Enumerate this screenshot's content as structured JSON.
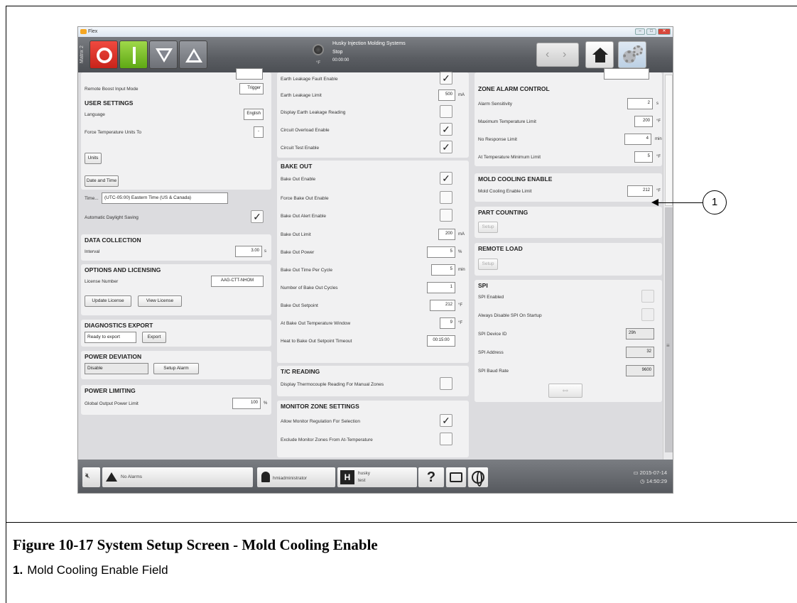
{
  "window": {
    "title": "Flex"
  },
  "header": {
    "matrix_label": "Matrix 2",
    "company": "Husky Injection Molding Systems",
    "state": "Stop",
    "time": "00:00:00",
    "temp_unit": "°F"
  },
  "col1": {
    "remote_boost_mode": {
      "label": "Remote Boost Input Mode",
      "value": "Trigger"
    },
    "user_settings": {
      "title": "USER SETTINGS",
      "language_label": "Language",
      "language_value": "English",
      "force_temp_label": "Force Temperature Units To",
      "force_temp_value": "-",
      "units_btn": "Units",
      "date_time_btn": "Date and Time",
      "time_label": "Time...",
      "time_value": "(UTC-05:00) Eastern Time (US & Canada)",
      "dst_label": "Automatic Daylight Saving"
    },
    "data_collection": {
      "title": "DATA COLLECTION",
      "interval_label": "Interval",
      "interval_value": "3.00",
      "interval_unit": "s"
    },
    "options": {
      "title": "OPTIONS AND LICENSING",
      "license_label": "License Number",
      "license_value": "AAG-CTT-NHOM",
      "update_btn": "Update License",
      "view_btn": "View License"
    },
    "diagnostics": {
      "title": "DIAGNOSTICS EXPORT",
      "status": "Ready to export",
      "export_btn": "Export"
    },
    "power_deviation": {
      "title": "POWER DEVIATION",
      "value": "Disable",
      "alarm_btn": "Setup Alarm"
    },
    "power_limiting": {
      "title": "POWER LIMITING",
      "label": "Global Output Power Limit",
      "value": "100",
      "unit": "%"
    }
  },
  "col2": {
    "rows_top": [
      {
        "label": "Earth Leakage Fault Enable",
        "checked": true
      },
      {
        "label": "Earth Leakage Limit",
        "value": "500",
        "unit": "mA"
      },
      {
        "label": "Display Earth Leakage Reading",
        "checked": false
      },
      {
        "label": "Circuit Overload Enable",
        "checked": true
      },
      {
        "label": "Circuit Test Enable",
        "checked": true
      }
    ],
    "bake_out": {
      "title": "BAKE OUT",
      "rows": [
        {
          "label": "Bake Out Enable",
          "checked": true
        },
        {
          "label": "Force Bake Out Enable",
          "checked": false
        },
        {
          "label": "Bake Out Alert Enable",
          "checked": false
        },
        {
          "label": "Bake Out Limit",
          "value": "200",
          "unit": "mA"
        },
        {
          "label": "Bake Out Power",
          "value": "5",
          "unit": "%"
        },
        {
          "label": "Bake Out Time Per Cycle",
          "value": "5",
          "unit": "min"
        },
        {
          "label": "Number of Bake Out Cycles",
          "value": "1",
          "unit": ""
        },
        {
          "label": "Bake Out Setpoint",
          "value": "212",
          "unit": "°F"
        },
        {
          "label": "At Bake Out Temperature Window",
          "value": "9",
          "unit": "°F"
        },
        {
          "label": "Heat to Bake Out Setpoint Timeout",
          "value": "00:15:00",
          "unit": ""
        }
      ]
    },
    "tc_reading": {
      "title": "T/C READING",
      "label": "Display Thermocouple Reading For Manual Zones"
    },
    "monitor": {
      "title": "MONITOR ZONE SETTINGS",
      "row1": "Allow Monitor Regulation For Selection",
      "row2": "Exclude Monitor Zones From At-Temperature"
    }
  },
  "col3": {
    "zone_alarm": {
      "title": "ZONE ALARM CONTROL",
      "rows": [
        {
          "label": "Alarm Sensitivity",
          "value": "2",
          "unit": "s"
        },
        {
          "label": "Maximum Temperature Limit",
          "value": "200",
          "unit": "°F"
        },
        {
          "label": "No Response Limit",
          "value": "4",
          "unit": "min"
        },
        {
          "label": "At Temperature Minimum Limit",
          "value": "5",
          "unit": "°F"
        }
      ]
    },
    "mold_cooling": {
      "title": "MOLD COOLING ENABLE",
      "label": "Mold Cooling Enable Limit",
      "value": "212",
      "unit": "°F"
    },
    "part_counting": {
      "title": "PART COUNTING",
      "btn": "Setup"
    },
    "remote_load": {
      "title": "REMOTE LOAD",
      "btn": "Setup"
    },
    "spi": {
      "title": "SPI",
      "enabled_label": "SPI Enabled",
      "disable_label": "Always Disable SPI On Startup",
      "device_label": "SPI Device ID",
      "device_value": "29h",
      "address_label": "SPI Address",
      "address_value": "32",
      "baud_label": "SPI Baud Rate",
      "baud_value": "9600"
    }
  },
  "footer": {
    "alarms": "No Alarms",
    "user": "hmiadministrator",
    "mold_name": "husky",
    "mold_sub": "test",
    "help": "?",
    "date": "2015-07-14",
    "time": "14:50:29"
  },
  "callout": {
    "number": "1"
  },
  "caption": {
    "title": "Figure 10-17 System Setup Screen - Mold Cooling Enable",
    "item_num": "1.",
    "item_text": "Mold Cooling Enable Field"
  }
}
